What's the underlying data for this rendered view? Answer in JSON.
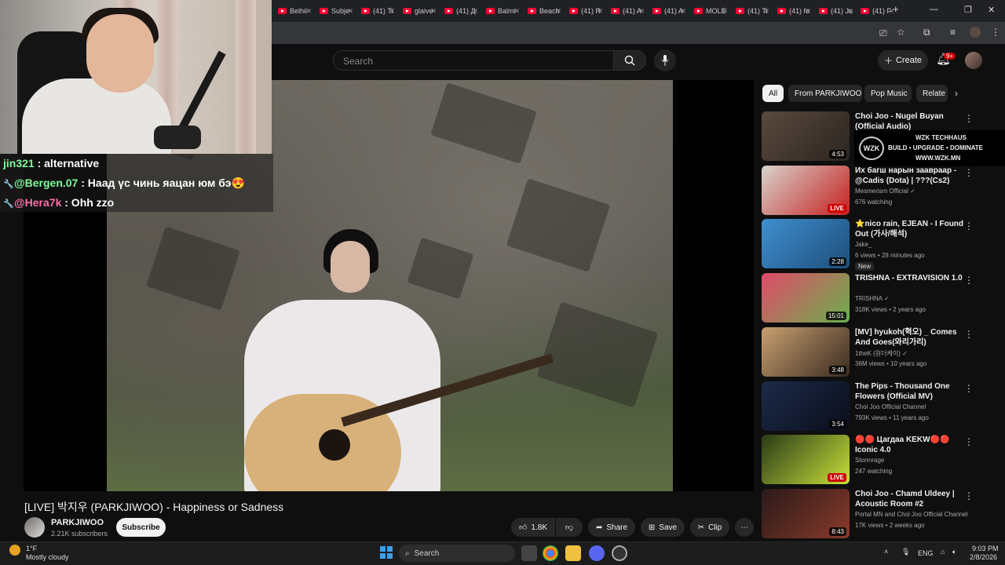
{
  "browser": {
    "tabs": [
      {
        "label": "Belhii"
      },
      {
        "label": "Subje"
      },
      {
        "label": "(41) Ti"
      },
      {
        "label": "glaive"
      },
      {
        "label": "(41) Д"
      },
      {
        "label": "Balmi"
      },
      {
        "label": "Beach"
      },
      {
        "label": "(41) R"
      },
      {
        "label": "(41) A"
      },
      {
        "label": "(41) A"
      },
      {
        "label": "MOLE"
      },
      {
        "label": "(41) Ti"
      },
      {
        "label": "(41) fo"
      },
      {
        "label": "(41) Ju"
      },
      {
        "label": "(41) F"
      }
    ],
    "new_tab": "+",
    "minimize": "—",
    "maximize": "❐",
    "close": "✕"
  },
  "masthead": {
    "search_placeholder": "Search",
    "create_label": "Create",
    "notifications_badge": "9+"
  },
  "stream_overlay": {
    "chat": [
      {
        "user": "jin321",
        "text": " : alternative",
        "user_color": "#7CFC9A",
        "badge": ""
      },
      {
        "user": "@Bergen.07",
        "text": " : Наад үс чинь яацан юм бэ😍",
        "user_color": "#7CFC9A",
        "badge": "🔧"
      },
      {
        "user": "@Hera7k",
        "text": " : Ohh zzo",
        "user_color": "#FF6FA8",
        "badge": "🔧"
      }
    ]
  },
  "video": {
    "title": "[LIVE] 박지우 (PARKJIWOO) - Happiness or Sadness",
    "channel_name": "PARKJIWOO",
    "subscribers": "2.21K subscribers",
    "subscribe_label": "Subscribe",
    "likes": "1.8K",
    "share_label": "Share",
    "save_label": "Save",
    "clip_label": "Clip"
  },
  "sidebar": {
    "chips": [
      {
        "label": "All"
      },
      {
        "label": "From PARKJIWOO"
      },
      {
        "label": "Pop Music"
      },
      {
        "label": "Relate"
      }
    ],
    "items": [
      {
        "title": "Choi Joo - Nugel Buyan (Official Audio)",
        "channel": "",
        "meta": "",
        "duration": "4:53",
        "live": "",
        "new": "",
        "thumb": [
          "#5a4a3e",
          "#2b2420"
        ]
      },
      {
        "title": "Их багш нарын заавраар - @Cadis (Dota) | ???(Cs2)",
        "channel": "Mesmerism Official ✓",
        "meta": "676 watching",
        "duration": "",
        "live": "LIVE",
        "new": "",
        "thumb": [
          "#d9d4cc",
          "#c42020"
        ]
      },
      {
        "title": "⭐nico rain, EJEAN - I Found Out (가사/해석)",
        "channel": "Jake_",
        "meta": "6 views • 28 minutes ago",
        "duration": "2:28",
        "live": "",
        "new": "New",
        "thumb": [
          "#3f8fd0",
          "#1d4e7a"
        ]
      },
      {
        "title": "TRISHNA - EXTRAVISION 1.0",
        "channel": "TRISHNA ✓",
        "meta": "318K views • 2 years ago",
        "duration": "15:01",
        "live": "",
        "new": "",
        "thumb": [
          "#e04a6a",
          "#6ab04c"
        ]
      },
      {
        "title": "[MV] hyukoh(혁오) _ Comes And Goes(와리가리)",
        "channel": "1theK (원더케이) ✓",
        "meta": "36M views • 10 years ago",
        "duration": "3:48",
        "live": "",
        "new": "",
        "thumb": [
          "#c8a070",
          "#3a2a20"
        ]
      },
      {
        "title": "The Pips - Thousand One Flowers (Official MV)",
        "channel": "Choi Joo Official Channel",
        "meta": "793K views • 11 years ago",
        "duration": "3:54",
        "live": "",
        "new": "",
        "thumb": [
          "#1c2a4a",
          "#0a0e1a"
        ]
      },
      {
        "title": "🔴🔴 Цагдаа KEKW🔴🔴 Iconic 4.0",
        "channel": "Stormrage",
        "meta": "247 watching",
        "duration": "",
        "live": "LIVE",
        "new": "",
        "thumb": [
          "#2a3a18",
          "#c7e03a"
        ]
      },
      {
        "title": "Choi Joo - Chamd Uldeey | Acoustic Room #2",
        "channel": "Portal MN and Choi Joo Official Channel",
        "meta": "17K views • 2 weeks ago",
        "duration": "8:43",
        "live": "",
        "new": "",
        "thumb": [
          "#2a1a1a",
          "#8a3a2a"
        ]
      }
    ]
  },
  "sponsor": {
    "logo": "WZK",
    "line1": "WZK TECHHAUS",
    "line2": "BUILD • UPGRADE • DOMINATE",
    "line3": "WWW.WZK.MN"
  },
  "taskbar": {
    "weather_temp": "1°F",
    "weather_desc": "Mostly cloudy",
    "search_label": "Search",
    "lang": "ENG",
    "time": "9:03 PM",
    "date": "2/8/2026"
  }
}
